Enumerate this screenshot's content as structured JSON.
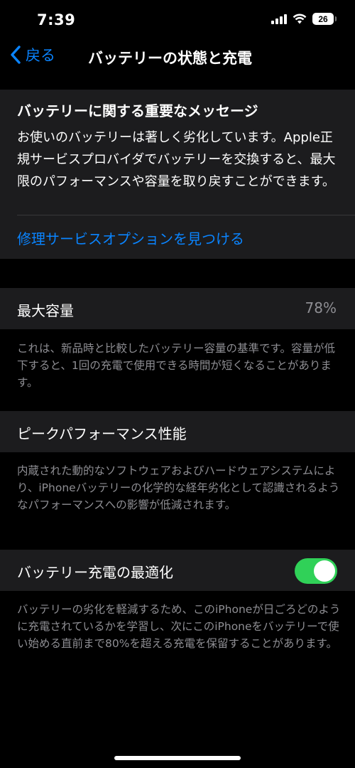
{
  "status_bar": {
    "time": "7:39",
    "battery_level": "26"
  },
  "nav": {
    "back_label": "戻る",
    "title": "バッテリーの状態と充電"
  },
  "message": {
    "title": "バッテリーに関する重要なメッセージ",
    "body": "お使いのバッテリーは著しく劣化しています。Apple正規サービスプロバイダでバッテリーを交換すると、最大限のパフォーマンスや容量を取り戻すことができます。",
    "link": "修理サービスオプションを見つける"
  },
  "max_capacity": {
    "label": "最大容量",
    "value": "78%",
    "footnote": "これは、新品時と比較したバッテリー容量の基準です。容量が低下すると、1回の充電で使用できる時間が短くなることがあります。"
  },
  "peak_performance": {
    "label": "ピークパフォーマンス性能",
    "footnote": "内蔵された動的なソフトウェアおよびハードウェアシステムにより、iPhoneバッテリーの化学的な経年劣化として認識されるようなパフォーマンスへの影響が低減されます。"
  },
  "optimized_charging": {
    "label": "バッテリー充電の最適化",
    "enabled": true,
    "footnote": "バッテリーの劣化を軽減するため、このiPhoneが日ごろどのように充電されているかを学習し、次にこのiPhoneをバッテリーで使い始める直前まで80%を超える充電を保留することがあります。"
  },
  "colors": {
    "background": "#000000",
    "card": "#1c1c1e",
    "accent": "#0a84ff",
    "toggle_on": "#30d158",
    "secondary_text": "#8e8e93"
  }
}
